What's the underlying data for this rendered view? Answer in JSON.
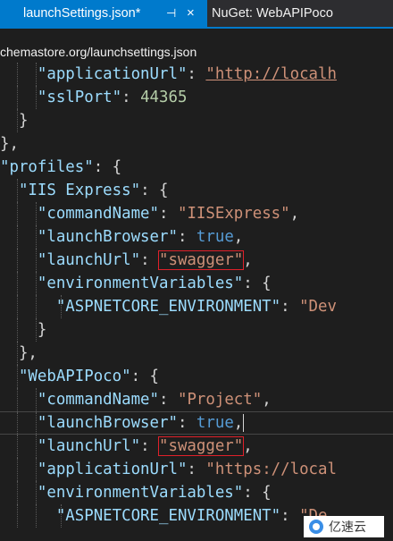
{
  "tabs": {
    "active": {
      "label": "launchSettings.json*",
      "pin_glyph": "⊣",
      "close_glyph": "×"
    },
    "inactive": {
      "label": "NuGet: WebAPIPoco"
    }
  },
  "schema_url": "chemastore.org/launchsettings.json",
  "colors": {
    "accent": "#007acc",
    "editor_bg": "#1e1e1e",
    "json_key": "#9cdcfe",
    "json_string": "#ce9178",
    "json_keyword": "#569cd6",
    "json_number": "#b5cea8",
    "highlight_box": "#e0202a"
  },
  "code": {
    "l1_indent": "    ",
    "l1_key": "\"applicationUrl\"",
    "l1_sep": ": ",
    "l1_value": "\"http://localh",
    "l2_indent": "    ",
    "l2_key": "\"sslPort\"",
    "l2_sep": ": ",
    "l2_value": "44365",
    "l3_text": "  }",
    "l4_text": "},",
    "l5_indent": "",
    "l5_key": "\"profiles\"",
    "l5_rest": ": {",
    "l6_indent": "  ",
    "l6_key": "\"IIS Express\"",
    "l6_rest": ": {",
    "l7_indent": "    ",
    "l7_key": "\"commandName\"",
    "l7_sep": ": ",
    "l7_value": "\"IISExpress\"",
    "l7_end": ",",
    "l8_indent": "    ",
    "l8_key": "\"launchBrowser\"",
    "l8_sep": ": ",
    "l8_value": "true",
    "l8_end": ",",
    "l9_indent": "    ",
    "l9_key": "\"launchUrl\"",
    "l9_sep": ": ",
    "l9_value": "\"swagger\"",
    "l9_end": ",",
    "l10_indent": "    ",
    "l10_key": "\"environmentVariables\"",
    "l10_rest": ": {",
    "l11_indent": "      ",
    "l11_key": "\"ASPNETCORE_ENVIRONMENT\"",
    "l11_sep": ": ",
    "l11_value": "\"Dev",
    "l12_text": "    }",
    "l13_text": "  },",
    "l14_indent": "  ",
    "l14_key": "\"WebAPIPoco\"",
    "l14_rest": ": {",
    "l15_indent": "    ",
    "l15_key": "\"commandName\"",
    "l15_sep": ": ",
    "l15_value": "\"Project\"",
    "l15_end": ",",
    "l16_indent": "    ",
    "l16_key": "\"launchBrowser\"",
    "l16_sep": ": ",
    "l16_value": "true",
    "l16_end": ",",
    "l17_indent": "    ",
    "l17_key": "\"launchUrl\"",
    "l17_sep": ": ",
    "l17_value": "\"swagger\"",
    "l17_end": ",",
    "l18_indent": "    ",
    "l18_key": "\"applicationUrl\"",
    "l18_sep": ": ",
    "l18_value": "\"https://local",
    "l19_indent": "    ",
    "l19_key": "\"environmentVariables\"",
    "l19_rest": ": {",
    "l20_indent": "      ",
    "l20_key": "\"ASPNETCORE_ENVIRONMENT\"",
    "l20_sep": ": ",
    "l20_value": "\"De"
  },
  "watermark": {
    "text": "亿速云",
    "icon": "yisu-logo-icon"
  }
}
